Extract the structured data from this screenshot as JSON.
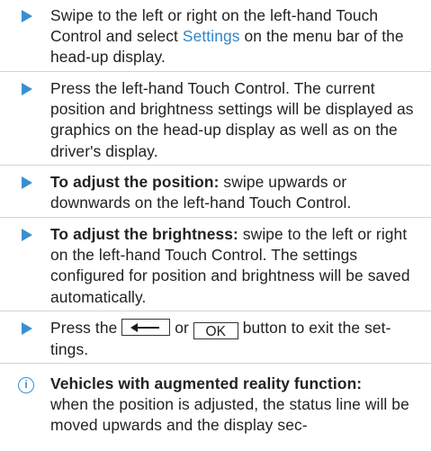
{
  "steps": [
    {
      "text_before": "Swipe to the left or right on the left-hand Touch Control and select ",
      "link": "Settings",
      "text_after": " on the menu bar of the head-up display."
    },
    {
      "text": "Press the left-hand Touch Control. The current position and brightness settings will be displayed as graphics on the head-up display as well as on the driver's display."
    },
    {
      "bold": "To adjust the position:",
      "text": " swipe upwards or downwards on the left-hand Touch Control."
    },
    {
      "bold": "To adjust the brightness:",
      "text": " swipe to the left or right on the left-hand Touch Control. The settings configured for position and brightness will be saved automatically."
    },
    {
      "text_before": "Press the ",
      "key_back_icon": "back-arrow-icon",
      "text_or": " or ",
      "key_ok": "OK",
      "text_after": " button to exit the set-tings."
    }
  ],
  "note": {
    "icon": "info-icon",
    "icon_glyph": "i",
    "bold": "Vehicles with augmented reality function:",
    "text": "when the position is adjusted, the status line will be moved upwards and the display sec-"
  },
  "colors": {
    "accent": "#3a8fd0",
    "link": "#2f86c8",
    "separator": "#d4d4d4"
  }
}
